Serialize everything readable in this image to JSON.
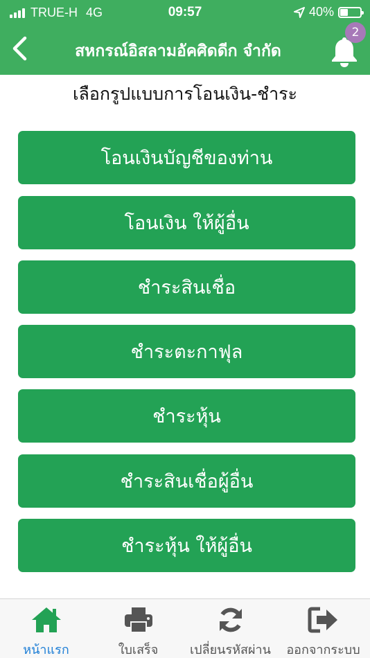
{
  "status_bar": {
    "carrier": "TRUE-H",
    "network": "4G",
    "time": "09:57",
    "battery": "40%",
    "battery_level": 0.4
  },
  "header": {
    "title": "สหกรณ์อิสลามอัคศิดดีก จำกัด",
    "notification_count": "2",
    "back_icon": "chevron-left-icon",
    "bell_icon": "bell-icon"
  },
  "page": {
    "subtitle": "เลือกรูปแบบการโอนเงิน-ชำระ"
  },
  "menu": [
    {
      "label": "โอนเงินบัญชีของท่าน"
    },
    {
      "label": "โอนเงิน ให้ผู้อื่น"
    },
    {
      "label": "ชำระสินเชื่อ"
    },
    {
      "label": "ชำระตะกาฟุล"
    },
    {
      "label": "ชำระหุ้น"
    },
    {
      "label": "ชำระสินเชื่อผู้อื่น"
    },
    {
      "label": "ชำระหุ้น ให้ผู้อื่น"
    }
  ],
  "tabs": [
    {
      "label": "หน้าแรก",
      "icon": "home-icon"
    },
    {
      "label": "ใบเสร็จ",
      "icon": "printer-icon"
    },
    {
      "label": "เปลี่ยนรหัสผ่าน",
      "icon": "refresh-icon"
    },
    {
      "label": "ออกจากระบบ",
      "icon": "logout-icon"
    }
  ],
  "colors": {
    "header": "#3fae5f",
    "button": "#23a255",
    "badge": "#a779b8",
    "active_tab": "#1f7fd6",
    "tab_icon": "#555555",
    "home_icon": "#23a255"
  }
}
